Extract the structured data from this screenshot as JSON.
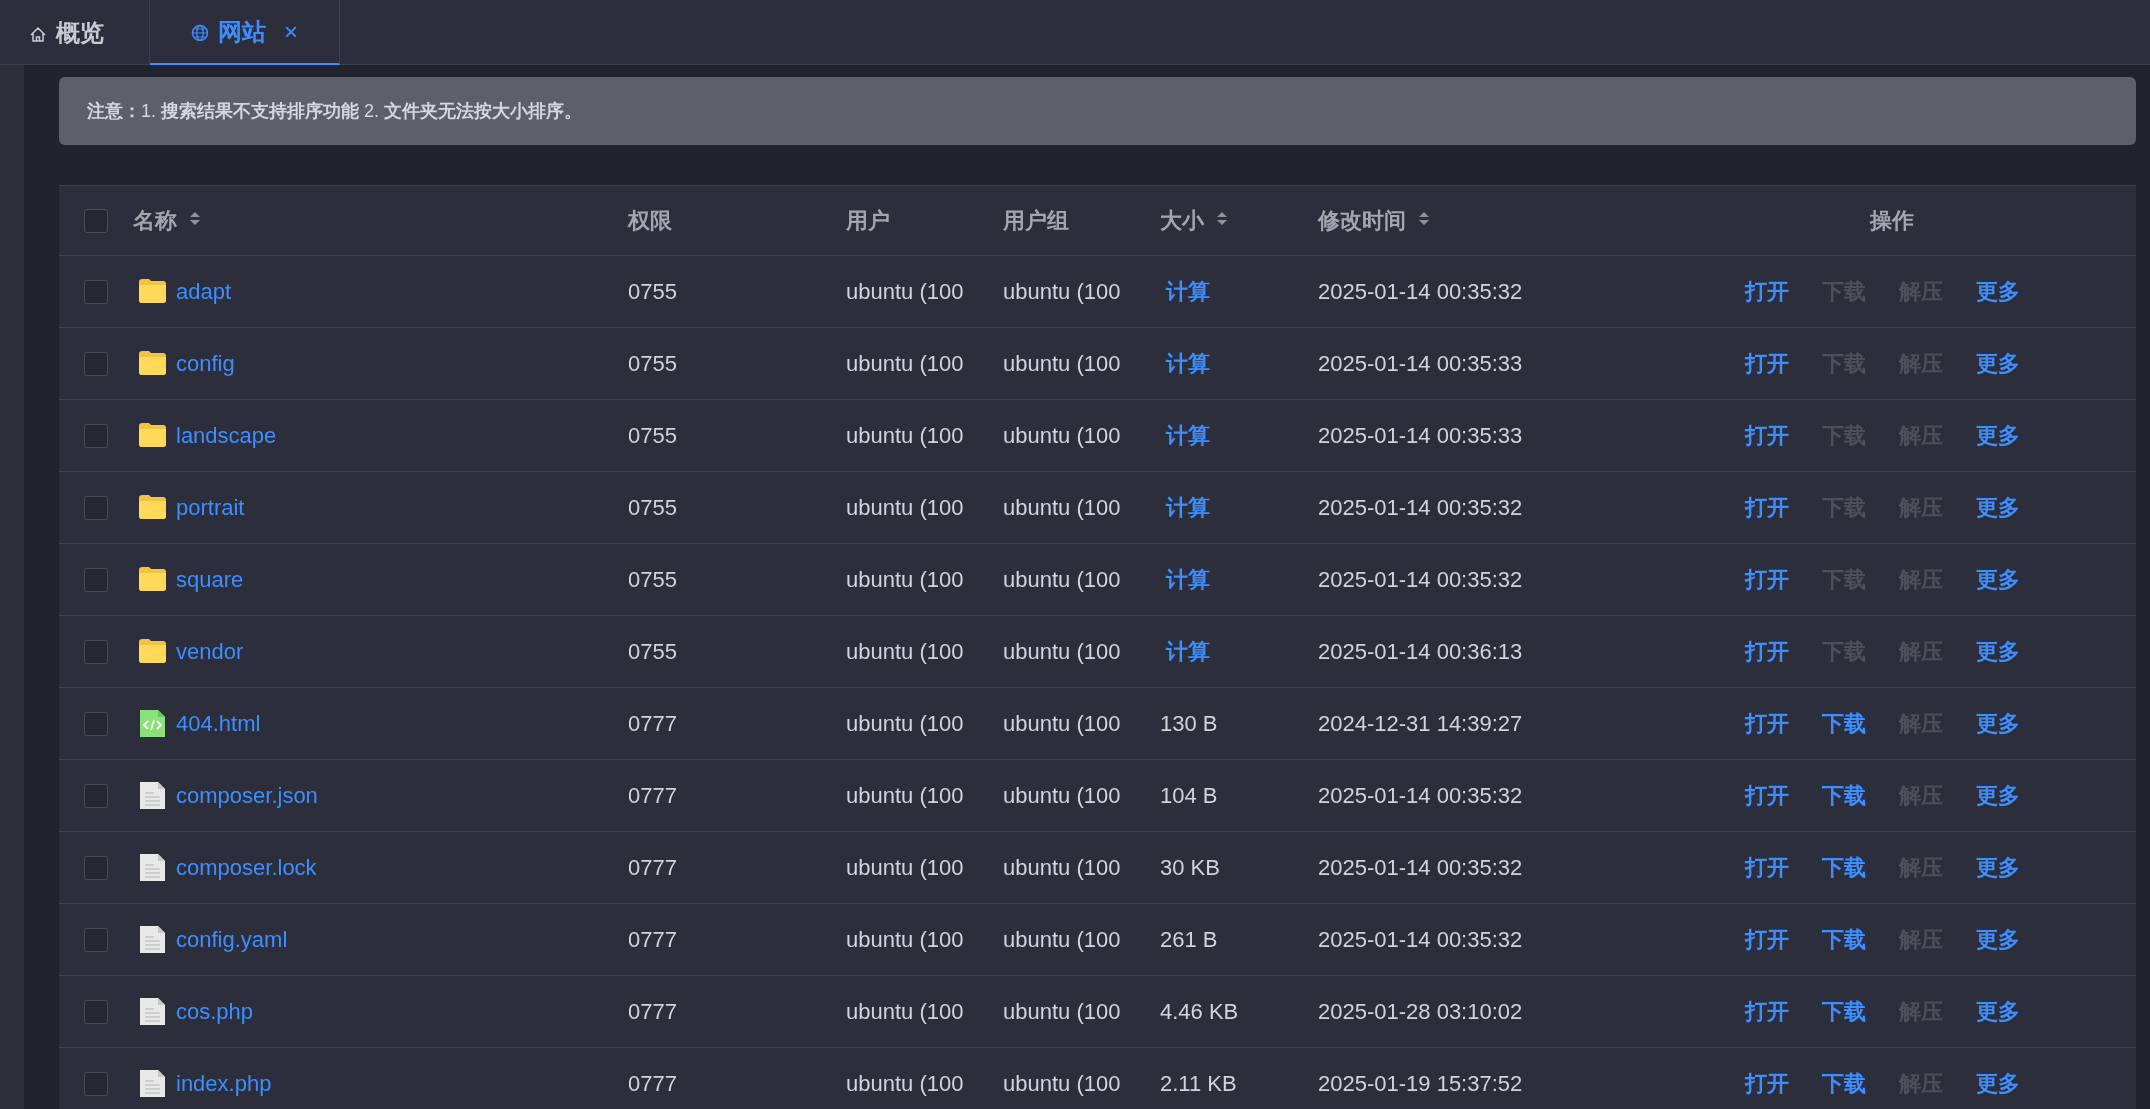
{
  "tabs": [
    {
      "label": "概览",
      "selected": false,
      "closable": false
    },
    {
      "label": "网站",
      "selected": true,
      "closable": true,
      "close": "×"
    }
  ],
  "notice": "**注意：**1. **搜索结果不支持排序功能** 2. **文件夹无法按大小排序。**",
  "table": {
    "select_all": {
      "checked": false
    },
    "columns": [
      {
        "label": "名称",
        "sortable": true
      },
      {
        "label": "权限",
        "sortable": false
      },
      {
        "label": "用户",
        "sortable": false
      },
      {
        "label": "用户组",
        "sortable": false
      },
      {
        "label": "大小",
        "sortable": true
      },
      {
        "label": "修改时间",
        "sortable": true
      },
      {
        "label": "操作",
        "sortable": false
      }
    ],
    "rows": [
      {
        "checked": false,
        "kind": "folder",
        "name": "adapt",
        "perm": "0755",
        "user": "ubuntu (100",
        "group": "ubuntu (100",
        "size": {
          "kind": "link",
          "text": "计算"
        },
        "modified": "2025-01-14 00:35:32",
        "actions": [
          {
            "label": "打开",
            "disabled": false
          },
          {
            "label": "下载",
            "disabled": true
          },
          {
            "label": "解压",
            "disabled": true
          },
          {
            "label": "更多",
            "disabled": false
          }
        ]
      },
      {
        "checked": false,
        "kind": "folder",
        "name": "config",
        "perm": "0755",
        "user": "ubuntu (100",
        "group": "ubuntu (100",
        "size": {
          "kind": "link",
          "text": "计算"
        },
        "modified": "2025-01-14 00:35:33",
        "actions": [
          {
            "label": "打开",
            "disabled": false
          },
          {
            "label": "下载",
            "disabled": true
          },
          {
            "label": "解压",
            "disabled": true
          },
          {
            "label": "更多",
            "disabled": false
          }
        ]
      },
      {
        "checked": false,
        "kind": "folder",
        "name": "landscape",
        "perm": "0755",
        "user": "ubuntu (100",
        "group": "ubuntu (100",
        "size": {
          "kind": "link",
          "text": "计算"
        },
        "modified": "2025-01-14 00:35:33",
        "actions": [
          {
            "label": "打开",
            "disabled": false
          },
          {
            "label": "下载",
            "disabled": true
          },
          {
            "label": "解压",
            "disabled": true
          },
          {
            "label": "更多",
            "disabled": false
          }
        ]
      },
      {
        "checked": false,
        "kind": "folder",
        "name": "portrait",
        "perm": "0755",
        "user": "ubuntu (100",
        "group": "ubuntu (100",
        "size": {
          "kind": "link",
          "text": "计算"
        },
        "modified": "2025-01-14 00:35:32",
        "actions": [
          {
            "label": "打开",
            "disabled": false
          },
          {
            "label": "下载",
            "disabled": true
          },
          {
            "label": "解压",
            "disabled": true
          },
          {
            "label": "更多",
            "disabled": false
          }
        ]
      },
      {
        "checked": false,
        "kind": "folder",
        "name": "square",
        "perm": "0755",
        "user": "ubuntu (100",
        "group": "ubuntu (100",
        "size": {
          "kind": "link",
          "text": "计算"
        },
        "modified": "2025-01-14 00:35:32",
        "actions": [
          {
            "label": "打开",
            "disabled": false
          },
          {
            "label": "下载",
            "disabled": true
          },
          {
            "label": "解压",
            "disabled": true
          },
          {
            "label": "更多",
            "disabled": false
          }
        ]
      },
      {
        "checked": false,
        "kind": "folder",
        "name": "vendor",
        "perm": "0755",
        "user": "ubuntu (100",
        "group": "ubuntu (100",
        "size": {
          "kind": "link",
          "text": "计算"
        },
        "modified": "2025-01-14 00:36:13",
        "actions": [
          {
            "label": "打开",
            "disabled": false
          },
          {
            "label": "下载",
            "disabled": true
          },
          {
            "label": "解压",
            "disabled": true
          },
          {
            "label": "更多",
            "disabled": false
          }
        ]
      },
      {
        "checked": false,
        "kind": "code",
        "name": "404.html",
        "perm": "0777",
        "user": "ubuntu (100",
        "group": "ubuntu (100",
        "size": {
          "kind": "text",
          "text": "130 B"
        },
        "modified": "2024-12-31 14:39:27",
        "actions": [
          {
            "label": "打开",
            "disabled": false
          },
          {
            "label": "下载",
            "disabled": false
          },
          {
            "label": "解压",
            "disabled": true
          },
          {
            "label": "更多",
            "disabled": false
          }
        ]
      },
      {
        "checked": false,
        "kind": "file",
        "name": "composer.json",
        "perm": "0777",
        "user": "ubuntu (100",
        "group": "ubuntu (100",
        "size": {
          "kind": "text",
          "text": "104 B"
        },
        "modified": "2025-01-14 00:35:32",
        "actions": [
          {
            "label": "打开",
            "disabled": false
          },
          {
            "label": "下载",
            "disabled": false
          },
          {
            "label": "解压",
            "disabled": true
          },
          {
            "label": "更多",
            "disabled": false
          }
        ]
      },
      {
        "checked": false,
        "kind": "file",
        "name": "composer.lock",
        "perm": "0777",
        "user": "ubuntu (100",
        "group": "ubuntu (100",
        "size": {
          "kind": "text",
          "text": "30 KB"
        },
        "modified": "2025-01-14 00:35:32",
        "actions": [
          {
            "label": "打开",
            "disabled": false
          },
          {
            "label": "下载",
            "disabled": false
          },
          {
            "label": "解压",
            "disabled": true
          },
          {
            "label": "更多",
            "disabled": false
          }
        ]
      },
      {
        "checked": false,
        "kind": "file",
        "name": "config.yaml",
        "perm": "0777",
        "user": "ubuntu (100",
        "group": "ubuntu (100",
        "size": {
          "kind": "text",
          "text": "261 B"
        },
        "modified": "2025-01-14 00:35:32",
        "actions": [
          {
            "label": "打开",
            "disabled": false
          },
          {
            "label": "下载",
            "disabled": false
          },
          {
            "label": "解压",
            "disabled": true
          },
          {
            "label": "更多",
            "disabled": false
          }
        ]
      },
      {
        "checked": false,
        "kind": "file",
        "name": "cos.php",
        "perm": "0777",
        "user": "ubuntu (100",
        "group": "ubuntu (100",
        "size": {
          "kind": "text",
          "text": "4.46 KB"
        },
        "modified": "2025-01-28 03:10:02",
        "actions": [
          {
            "label": "打开",
            "disabled": false
          },
          {
            "label": "下载",
            "disabled": false
          },
          {
            "label": "解压",
            "disabled": true
          },
          {
            "label": "更多",
            "disabled": false
          }
        ]
      },
      {
        "checked": false,
        "kind": "file",
        "name": "index.php",
        "perm": "0777",
        "user": "ubuntu (100",
        "group": "ubuntu (100",
        "size": {
          "kind": "text",
          "text": "2.11 KB"
        },
        "modified": "2025-01-19 15:37:52",
        "actions": [
          {
            "label": "打开",
            "disabled": false
          },
          {
            "label": "下载",
            "disabled": false
          },
          {
            "label": "解压",
            "disabled": true
          },
          {
            "label": "更多",
            "disabled": false
          }
        ]
      }
    ]
  }
}
